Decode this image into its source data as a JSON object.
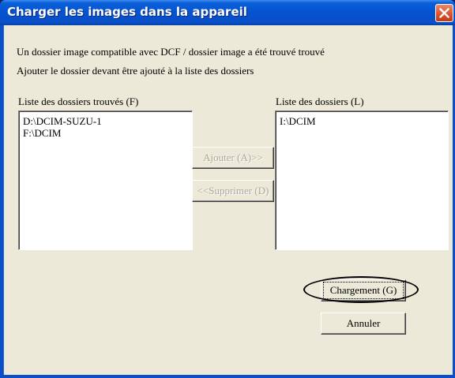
{
  "window": {
    "title": "Charger les images dans la appareil",
    "close_icon": "close-icon"
  },
  "message": {
    "line1": "Un dossier image compatible avec DCF / dossier image a été trouvé trouvé",
    "line2": "Ajouter le dossier devant être ajouté à la liste des dossiers"
  },
  "found_list": {
    "label": "Liste des dossiers trouvés (F)",
    "items": [
      "D:\\DCIM-SUZU-1",
      "F:\\DCIM"
    ]
  },
  "folder_list": {
    "label": "Liste des dossiers (L)",
    "items": [
      "I:\\DCIM"
    ]
  },
  "buttons": {
    "add": "Ajouter (A)>>",
    "remove": "<<Supprimer (D)",
    "load": "Chargement (G)",
    "cancel": "Annuler"
  },
  "colors": {
    "titlebar": "#0552d0",
    "dialog_bg": "#ece9d8",
    "close_button": "#d9502a"
  }
}
